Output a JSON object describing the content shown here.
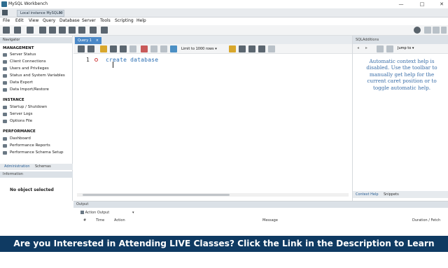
{
  "window": {
    "title": "MySQL Workbench",
    "minimize": "—",
    "maximize": "□",
    "close": "✕"
  },
  "connection_tab": {
    "label": "Local instance MySQL80",
    "close": "×"
  },
  "menu": [
    "File",
    "Edit",
    "View",
    "Query",
    "Database",
    "Server",
    "Tools",
    "Scripting",
    "Help"
  ],
  "navigator": {
    "header": "Navigator",
    "management": {
      "title": "MANAGEMENT",
      "items": [
        "Server Status",
        "Client Connections",
        "Users and Privileges",
        "Status and System Variables",
        "Data Export",
        "Data Import/Restore"
      ]
    },
    "instance": {
      "title": "INSTANCE",
      "items": [
        "Startup / Shutdown",
        "Server Logs",
        "Options File"
      ]
    },
    "performance": {
      "title": "PERFORMANCE",
      "items": [
        "Dashboard",
        "Performance Reports",
        "Performance Schema Setup"
      ]
    },
    "tabs": [
      "Administration",
      "Schemas"
    ],
    "info_header": "Information",
    "no_object": "No object selected"
  },
  "query_tab": {
    "label": "Query 1",
    "close": "×"
  },
  "editor_toolbar": {
    "limit": "Limit to 1000 rows"
  },
  "editor": {
    "line_number": "1",
    "code": "create database"
  },
  "sql_additions": {
    "header": "SQLAdditions",
    "jump_to": "Jump to",
    "help_text": "Automatic context help is disabled. Use the toolbar to manually get help for the current caret position or to toggle automatic help.",
    "tabs": [
      "Context Help",
      "Snippets"
    ]
  },
  "output": {
    "header": "Output",
    "selector": "Action Output",
    "columns": [
      "#",
      "Time",
      "Action",
      "Message",
      "Duration / Fetch"
    ]
  },
  "banner": {
    "text": "Are you Interested in Attending LIVE Classes? Click the Link in the Description to Learn More.",
    "arrow": "⬇"
  },
  "colors": {
    "banner_bg": "#0f3a62",
    "accent": "#4a88c7",
    "code_blue": "#2c6fb3",
    "help_blue": "#3a6ea8"
  }
}
